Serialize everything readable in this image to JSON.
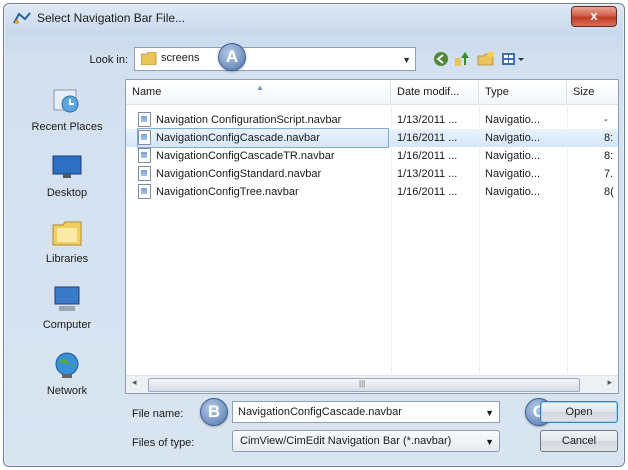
{
  "window": {
    "title": "Select Navigation Bar File..."
  },
  "titlebar": {
    "close_label": "x"
  },
  "lookin": {
    "label": "Look in:",
    "value": "screens"
  },
  "callouts": {
    "a": "A",
    "b": "B",
    "c": "C"
  },
  "toolbar": {
    "icons": [
      "back-icon",
      "up-folder-icon",
      "new-folder-icon",
      "views-menu-icon"
    ]
  },
  "places": [
    {
      "label": "Recent Places",
      "icon": "recent-places-icon"
    },
    {
      "label": "Desktop",
      "icon": "desktop-icon"
    },
    {
      "label": "Libraries",
      "icon": "libraries-icon"
    },
    {
      "label": "Computer",
      "icon": "computer-icon"
    },
    {
      "label": "Network",
      "icon": "network-icon"
    }
  ],
  "columns": [
    "Name",
    "Date modif...",
    "Type",
    "Size"
  ],
  "files": [
    {
      "name": "Navigation ConfigurationScript.navbar",
      "date": "1/13/2011 ...",
      "type": "Navigatio...",
      "size": "-",
      "selected": false
    },
    {
      "name": "NavigationConfigCascade.navbar",
      "date": "1/16/2011 ...",
      "type": "Navigatio...",
      "size": "8:",
      "selected": true
    },
    {
      "name": "NavigationConfigCascadeTR.navbar",
      "date": "1/16/2011 ...",
      "type": "Navigatio...",
      "size": "8:",
      "selected": false
    },
    {
      "name": "NavigationConfigStandard.navbar",
      "date": "1/13/2011 ...",
      "type": "Navigatio...",
      "size": "7.",
      "selected": false
    },
    {
      "name": "NavigationConfigTree.navbar",
      "date": "1/16/2011 ...",
      "type": "Navigatio...",
      "size": "8(",
      "selected": false
    }
  ],
  "scrollbar": {
    "grip": "|||",
    "left_arrow": "◂",
    "right_arrow": "▸"
  },
  "filename": {
    "label": "File name:",
    "value": "NavigationConfigCascade.navbar"
  },
  "filetype": {
    "label": "Files of type:",
    "value": "CimView/CimEdit Navigation Bar (*.navbar)"
  },
  "buttons": {
    "open": "Open",
    "cancel": "Cancel"
  },
  "colors": {
    "accent": "#3c7fb1",
    "close": "#c23d24",
    "selection": "#d3e6fa",
    "callout": "#6d8fbe"
  }
}
